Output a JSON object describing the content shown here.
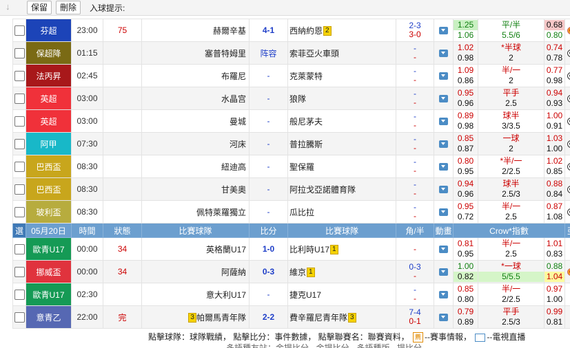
{
  "toolbar": {
    "keep": "保留",
    "delete": "刪除",
    "goal_hint": "入球提示:"
  },
  "header": {
    "select": "選",
    "date": "05月20日",
    "time": "時間",
    "status": "狀態",
    "home_team": "比賽球隊",
    "score": "比分",
    "away_team": "比賽球隊",
    "corner_half": "角/半",
    "animation": "動畫",
    "odds": "Crow*指數",
    "extra": "亞"
  },
  "colors": {
    "header_bg": "#6c9fcf",
    "score_blue": "#1e3ec8",
    "status_red": "#c00000",
    "odds_green": "#118011"
  },
  "rows": [
    {
      "league": "芬超",
      "league_color": "#1c44b8",
      "time": "23:00",
      "status": "75",
      "home": "赫爾辛基",
      "home_badge": "",
      "score": "4-1",
      "away": "西納約恩",
      "away_badge": "2",
      "ht1": "2-3",
      "ht2": "3-0",
      "o1a": "1.25",
      "o1b": "1.06",
      "o2a": "平/半",
      "o2b": "5.5/6",
      "o3a": "0.68",
      "o3b": "0.80",
      "icon": "ball-orange"
    },
    {
      "league": "保超降",
      "league_color": "#7a6a14",
      "time": "01:15",
      "status": "",
      "home": "塞普特姆里",
      "home_badge": "",
      "score": "阵容",
      "away": "索菲亞火車頭",
      "away_badge": "",
      "ht1": "-",
      "ht2": "-",
      "o1a": "1.02",
      "o1b": "0.98",
      "o2a": "*半球",
      "o2b": "2",
      "o3a": "0.74",
      "o3b": "0.78",
      "icon": "ball"
    },
    {
      "league": "法丙昇",
      "league_color": "#a8181a",
      "time": "02:45",
      "status": "",
      "home": "布羅尼",
      "home_badge": "",
      "score": "-",
      "away": "克萊蒙特",
      "away_badge": "",
      "ht1": "-",
      "ht2": "-",
      "o1a": "1.09",
      "o1b": "0.86",
      "o2a": "半/一",
      "o2b": "2",
      "o3a": "0.77",
      "o3b": "0.98",
      "icon": "ball"
    },
    {
      "league": "英超",
      "league_color": "#f0313a",
      "time": "03:00",
      "status": "",
      "home": "水晶宫",
      "home_badge": "",
      "score": "-",
      "away": "狼隊",
      "away_badge": "",
      "ht1": "-",
      "ht2": "-",
      "o1a": "0.95",
      "o1b": "0.96",
      "o2a": "平手",
      "o2b": "2.5",
      "o3a": "0.94",
      "o3b": "0.93",
      "icon": "ball"
    },
    {
      "league": "英超",
      "league_color": "#f0313a",
      "time": "03:00",
      "status": "",
      "home": "曼城",
      "home_badge": "",
      "score": "-",
      "away": "般尼茅夫",
      "away_badge": "",
      "ht1": "-",
      "ht2": "-",
      "o1a": "0.89",
      "o1b": "0.98",
      "o2a": "球半",
      "o2b": "3/3.5",
      "o3a": "1.00",
      "o3b": "0.91",
      "icon": "ball"
    },
    {
      "league": "阿甲",
      "league_color": "#18b8c8",
      "time": "07:30",
      "status": "",
      "home": "河床",
      "home_badge": "",
      "score": "-",
      "away": "普拉騰斯",
      "away_badge": "",
      "ht1": "-",
      "ht2": "-",
      "o1a": "0.85",
      "o1b": "0.87",
      "o2a": "一球",
      "o2b": "2",
      "o3a": "1.03",
      "o3b": "1.00",
      "icon": "ball"
    },
    {
      "league": "巴西盃",
      "league_color": "#c8a61c",
      "time": "08:30",
      "status": "",
      "home": "紐迪高",
      "home_badge": "",
      "score": "-",
      "away": "聖保羅",
      "away_badge": "",
      "ht1": "-",
      "ht2": "-",
      "o1a": "0.80",
      "o1b": "0.95",
      "o2a": "*半/一",
      "o2b": "2/2.5",
      "o3a": "1.02",
      "o3b": "0.85",
      "icon": "ball"
    },
    {
      "league": "巴西盃",
      "league_color": "#c8a61c",
      "time": "08:30",
      "status": "",
      "home": "甘美奧",
      "home_badge": "",
      "score": "-",
      "away": "阿拉戈亞諾體育隊",
      "away_badge": "",
      "ht1": "-",
      "ht2": "-",
      "o1a": "0.94",
      "o1b": "0.96",
      "o2a": "球半",
      "o2b": "2.5/3",
      "o3a": "0.88",
      "o3b": "0.84",
      "icon": "ball"
    },
    {
      "league": "玻利盃",
      "league_color": "#b7ac3e",
      "time": "08:30",
      "status": "",
      "home": "佩特萊羅獨立",
      "home_badge": "",
      "score": "-",
      "away": "瓜比拉",
      "away_badge": "",
      "ht1": "-",
      "ht2": "-",
      "o1a": "0.95",
      "o1b": "0.72",
      "o2a": "半/一",
      "o2b": "2.5",
      "o3a": "0.87",
      "o3b": "1.08",
      "icon": "ball"
    }
  ],
  "rows2": [
    {
      "league": "歐青U17",
      "league_color": "#159a55",
      "time": "00:00",
      "status": "34",
      "home": "英格蘭U17",
      "home_badge": "",
      "score": "1-0",
      "away": "比利時U17",
      "away_badge": "1",
      "ht1": "",
      "ht2": "-",
      "o1a": "0.81",
      "o1b": "0.95",
      "o2a": "半/一",
      "o2b": "2.5",
      "o3a": "1.01",
      "o3b": "0.83",
      "icon": "none"
    },
    {
      "league": "挪威盃",
      "league_color": "#e0333d",
      "time": "00:00",
      "status": "34",
      "home": "阿薩納",
      "home_badge": "",
      "score": "0-3",
      "away": "維京",
      "away_badge": "1",
      "ht1": "0-3",
      "ht2": "-",
      "o1a": "1.00",
      "o1b": "0.82",
      "o2a": "*一球",
      "o2b": "5/5.5",
      "o3a": "0.88",
      "o3b": "1.04",
      "icon": "ball-orange"
    },
    {
      "league": "歐青U17",
      "league_color": "#159a55",
      "time": "02:30",
      "status": "",
      "home": "意大利U17",
      "home_badge": "",
      "score": "-",
      "away": "捷克U17",
      "away_badge": "",
      "ht1": "-",
      "ht2": "-",
      "o1a": "0.85",
      "o1b": "0.80",
      "o2a": "半/一",
      "o2b": "2/2.5",
      "o3a": "0.97",
      "o3b": "1.00",
      "icon": "none"
    },
    {
      "league": "意青乙",
      "league_color": "#5668b3",
      "time": "22:00",
      "status": "完",
      "home": "帕爾馬青年隊",
      "home_badge": "3",
      "score": "2-2",
      "away": "費辛羅尼青年隊",
      "away_badge": "3",
      "ht1": "7-4",
      "ht2": "0-1",
      "o1a": "0.79",
      "o1b": "0.89",
      "o2a": "平手",
      "o2b": "2.5/3",
      "o3a": "0.99",
      "o3b": "0.81",
      "icon": "none"
    }
  ],
  "footer": {
    "line1": "點擊球隊：球隊戰績，  點擊比分：事件數據，  點擊聯賽名：聯賽資料，",
    "news_icon": "薦",
    "news_text": "--賽事情報，",
    "tv_text": "--電視直播",
    "line2": "多語種友站：金提比分 · 金提比分 · 多語種版 · 提比分"
  }
}
